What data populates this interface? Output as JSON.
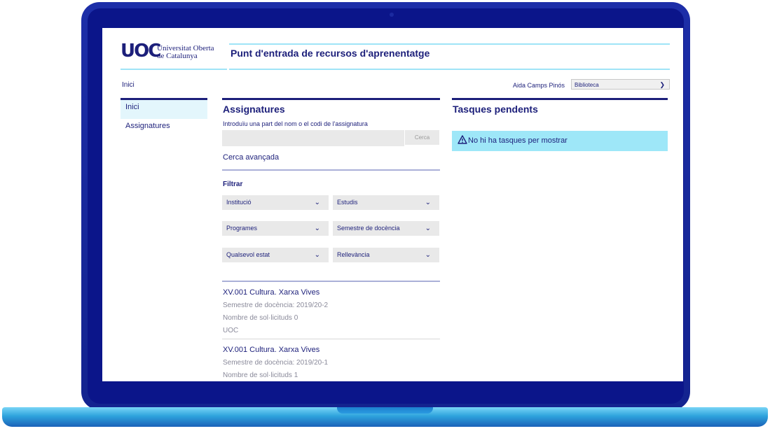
{
  "header": {
    "logo_mark": "UOC",
    "logo_text": "Universitat Oberta\nde Catalunya",
    "title": "Punt d'entrada de recursos d'aprenentatge"
  },
  "breadcrumb": "Inici",
  "user": {
    "name": "Aida Camps Pinós",
    "select_value": "Biblioteca"
  },
  "sidebar": {
    "items": [
      {
        "label": "Inici",
        "active": true
      },
      {
        "label": "Assignatures",
        "active": false
      }
    ]
  },
  "assignatures": {
    "title": "Assignatures",
    "hint": "Introduïu una part del nom o el codi de l'assignatura",
    "search_value": "",
    "search_button": "Cerca",
    "advanced_link": "Cerca avançada",
    "filter_title": "Filtrar",
    "filters": [
      "Institució",
      "Estudis",
      "Programes",
      "Semestre de docència",
      "Qualsevol estat",
      "Rellevància"
    ],
    "results": [
      {
        "title": "XV.001 Cultura. Xarxa Vives",
        "semester": "Semestre de docència: 2019/20-2",
        "requests": "Nombre de sol·licituds 0",
        "institution": "UOC"
      },
      {
        "title": "XV.001 Cultura. Xarxa Vives",
        "semester": "Semestre de docència: 2019/20-1",
        "requests": "Nombre de sol·licituds 1"
      }
    ]
  },
  "tasques": {
    "title": "Tasques pendents",
    "empty_message": "No hi ha tasques per mostrar"
  },
  "colors": {
    "frame": "#13238f",
    "base": "#2ea3dd",
    "navy": "#1c1f7a",
    "accent": "#9ee7f8"
  }
}
